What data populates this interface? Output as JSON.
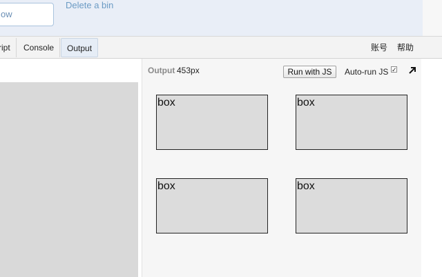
{
  "header": {
    "input_value": "ow",
    "delete_link": "Delete a bin"
  },
  "toolbar": {
    "tabs": [
      {
        "label": "ript"
      },
      {
        "label": "Console"
      },
      {
        "label": "Output"
      }
    ],
    "account": [
      "账号",
      "帮助"
    ]
  },
  "output": {
    "label": "Output",
    "size": "453px",
    "run_button": "Run with JS",
    "autorun_label": "Auto-run JS",
    "autorun_checked": true
  },
  "boxes": [
    "box",
    "box",
    "box",
    "box"
  ],
  "colors": {
    "header_bg": "#e9eef7",
    "link": "#6b9bc4",
    "box_fill": "#dcdcdc",
    "pane_gray": "#d9d9d9"
  }
}
